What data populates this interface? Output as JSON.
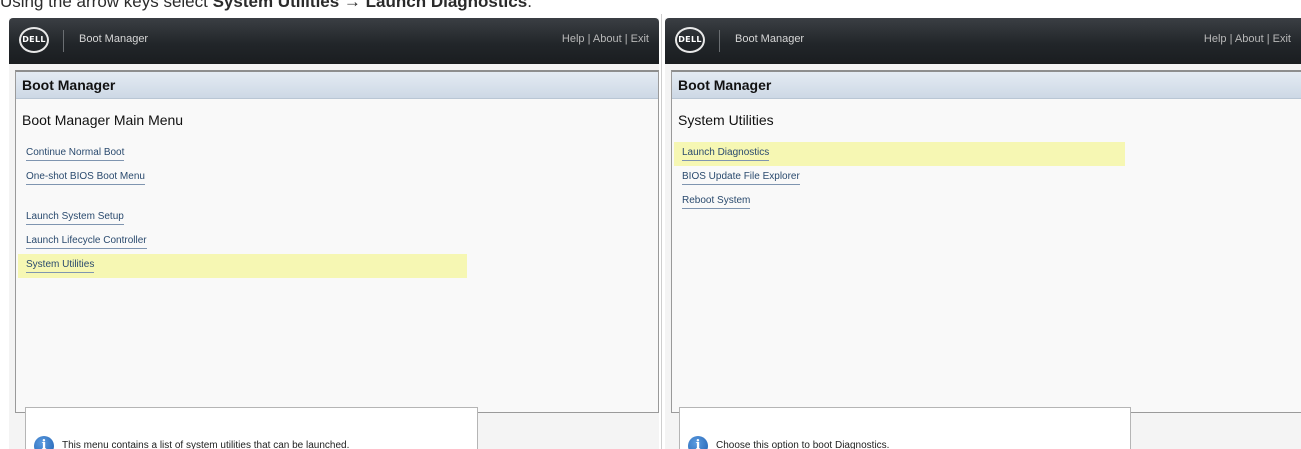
{
  "instruction": {
    "prefix": "Using the arrow keys select ",
    "step1": "System Utilities",
    "arrow": " → ",
    "step2": "Launch Diagnostics",
    "suffix": "."
  },
  "left_panel": {
    "topbar": {
      "logo": "DELL",
      "title": "Boot Manager",
      "help": "Help",
      "about": "About",
      "exit": "Exit",
      "separator": " | "
    },
    "header": "Boot Manager",
    "section_title": "Boot Manager Main Menu",
    "items": [
      {
        "label": "Continue Normal Boot"
      },
      {
        "label": "One-shot BIOS Boot Menu"
      },
      {
        "label": "Launch System Setup"
      },
      {
        "label": "Launch Lifecycle Controller"
      },
      {
        "label": "System Utilities"
      }
    ],
    "selected_index": 4,
    "info": "This menu contains a list of system utilities that can be launched."
  },
  "right_panel": {
    "topbar": {
      "logo": "DELL",
      "title": "Boot Manager",
      "help": "Help",
      "about": "About",
      "exit": "Exit",
      "separator": " | "
    },
    "header": "Boot Manager",
    "section_title": "System Utilities",
    "items": [
      {
        "label": "Launch Diagnostics"
      },
      {
        "label": "BIOS Update File Explorer"
      },
      {
        "label": "Reboot System"
      }
    ],
    "selected_index": 0,
    "info": "Choose this option to boot Diagnostics."
  },
  "colors": {
    "highlight": "#f6f7b3",
    "header_bar": "#d6dfea",
    "topbar": "#23272b",
    "link": "#2a4a6e"
  },
  "icons": {
    "logo": "dell-logo",
    "info": "info-icon"
  }
}
